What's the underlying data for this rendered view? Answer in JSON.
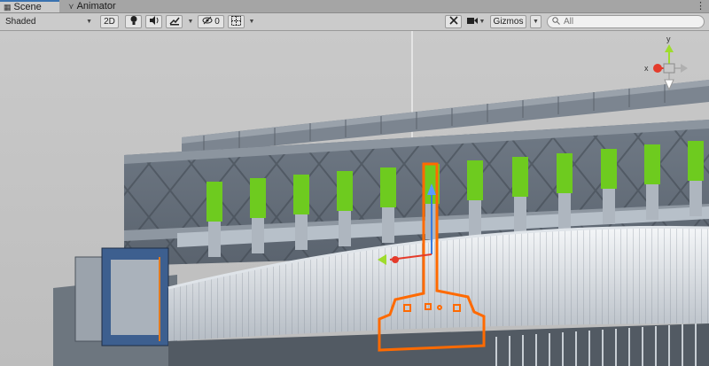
{
  "tabs": [
    {
      "label": "Scene",
      "icon": "grid-icon",
      "active": true
    },
    {
      "label": "Animator",
      "icon": "animator-icon",
      "active": false
    }
  ],
  "toolbar": {
    "draw_mode": "Shaded",
    "mode_2d_label": "2D",
    "hidden_count": "0",
    "gizmos_label": "Gizmos",
    "search_placeholder": "All"
  },
  "orientation_gizmo": {
    "y_label": "y",
    "x_label": "x"
  },
  "colors": {
    "toolbar_bg": "#cbcbcb",
    "tab_accent": "#3a72b0",
    "pier_green": "#6ecb1f",
    "selection_outline": "#ff6a00",
    "axis_x": "#e43b2b",
    "axis_y": "#9fdc2d",
    "axis_z": "#3a7be0"
  }
}
